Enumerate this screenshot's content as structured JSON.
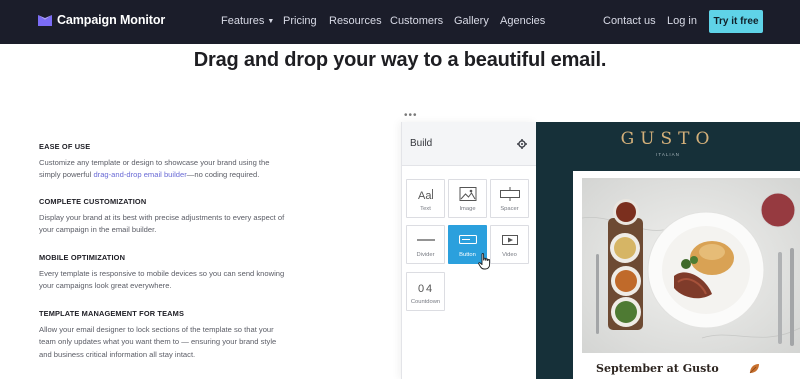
{
  "nav": {
    "brand": "Campaign Monitor",
    "links": [
      "Features",
      "Pricing",
      "Resources",
      "Customers",
      "Gallery",
      "Agencies"
    ],
    "contact": "Contact us",
    "login": "Log in",
    "cta": "Try it free",
    "colors": {
      "bar": "#1b1d2a",
      "cta": "#5fd3e8",
      "logo_mark": "#7b6cf6"
    }
  },
  "headline": "Drag and drop your way to a beautiful email.",
  "features": [
    {
      "title": "EASE OF USE",
      "text_before": "Customize any template or design to showcase your brand using the simply powerful ",
      "link": "drag-and-drop email builder",
      "text_after": "—no coding required."
    },
    {
      "title": "COMPLETE CUSTOMIZATION",
      "text": "Display your brand at its best with precise adjustments to every aspect of your campaign in the email builder."
    },
    {
      "title": "MOBILE OPTIMIZATION",
      "text": "Every template is responsive to mobile devices so you can send knowing your campaigns look great everywhere."
    },
    {
      "title": "TEMPLATE MANAGEMENT FOR TEAMS",
      "text": "Allow your email designer to lock sections of the template so that your team only updates what you want them to — ensuring your brand style and business critical information all stay intact."
    }
  ],
  "builder": {
    "title": "Build",
    "tiles": [
      {
        "label": "Text",
        "icon": "text-icon"
      },
      {
        "label": "Image",
        "icon": "image-icon"
      },
      {
        "label": "Spacer",
        "icon": "spacer-icon"
      },
      {
        "label": "Divider",
        "icon": "divider-icon"
      },
      {
        "label": "Button",
        "icon": "button-icon",
        "active": true
      },
      {
        "label": "Video",
        "icon": "video-icon"
      },
      {
        "label": "Countdown",
        "icon": "countdown-icon"
      }
    ],
    "colors": {
      "active_tile": "#2ba0dd"
    }
  },
  "email": {
    "brand": "GUSTO",
    "brand_sub": "ITALIAN",
    "heading": "September at Gusto",
    "colors": {
      "background": "#163039",
      "brand": "#d4b07a"
    }
  }
}
